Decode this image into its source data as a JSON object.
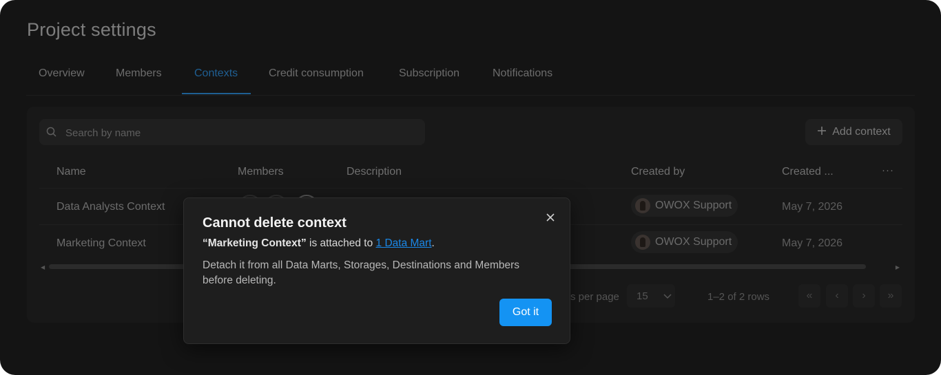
{
  "page": {
    "title": "Project settings"
  },
  "tabs": [
    {
      "label": "Overview"
    },
    {
      "label": "Members"
    },
    {
      "label": "Contexts"
    },
    {
      "label": "Credit consumption"
    },
    {
      "label": "Subscription"
    },
    {
      "label": "Notifications"
    }
  ],
  "active_tab": "Contexts",
  "search": {
    "placeholder": "Search by name"
  },
  "add_context": {
    "label": "Add context"
  },
  "table": {
    "columns": [
      "Name",
      "Members",
      "Description",
      "Created by",
      "Created ..."
    ],
    "more_icon": "ellipsis-icon",
    "rows": [
      {
        "name": "Data Analysts Context",
        "created_by": "OWOX Support",
        "created": "May 7, 2026"
      },
      {
        "name": "Marketing Context",
        "created_by": "OWOX Support",
        "created": "May 7, 2026"
      }
    ]
  },
  "pagination": {
    "rows_per_page_label": "s per page",
    "rows_per_page": "15",
    "range": "1–2 of 2 rows"
  },
  "modal": {
    "title": "Cannot delete context",
    "quoted_name": "“Marketing Context”",
    "attached_text": " is attached to ",
    "link": "1 Data Mart",
    "period": ".",
    "detail": "Detach it from all Data Marts, Storages, Destinations and Members before deleting.",
    "confirm": "Got it"
  },
  "colors": {
    "accent": "#1493f3",
    "link": "#1a88e8",
    "background": "#141414"
  }
}
